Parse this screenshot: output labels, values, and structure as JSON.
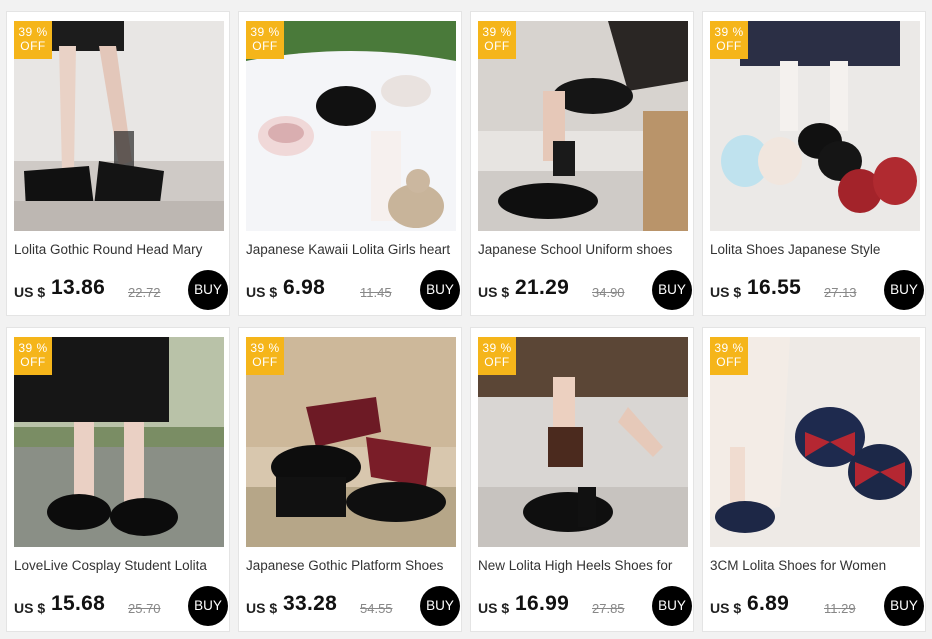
{
  "products": [
    {
      "discount_pct": "39 %",
      "discount_off": "OFF",
      "title": "Lolita Gothic Round Head Mary",
      "currency": "US $",
      "price": "13.86",
      "old_price": "22.72",
      "buy_label": "BUY",
      "image_desc": "legs-black-platform-shoes"
    },
    {
      "discount_pct": "39 %",
      "discount_off": "OFF",
      "title": "Japanese Kawaii Lolita Girls heart",
      "currency": "US $",
      "price": "6.98",
      "old_price": "11.45",
      "buy_label": "BUY",
      "image_desc": "shoes-on-white-blanket-bunny"
    },
    {
      "discount_pct": "39 %",
      "discount_off": "OFF",
      "title": "Japanese School Uniform shoes",
      "currency": "US $",
      "price": "21.29",
      "old_price": "34.90",
      "buy_label": "BUY",
      "image_desc": "black-loafers-on-steps"
    },
    {
      "discount_pct": "39 %",
      "discount_off": "OFF",
      "title": "Lolita Shoes Japanese Style",
      "currency": "US $",
      "price": "16.55",
      "old_price": "27.13",
      "buy_label": "BUY",
      "image_desc": "colorful-bow-shoes"
    },
    {
      "discount_pct": "39 %",
      "discount_off": "OFF",
      "title": "LoveLive Cosplay Student Lolita",
      "currency": "US $",
      "price": "15.68",
      "old_price": "25.70",
      "buy_label": "BUY",
      "image_desc": "platform-strap-shoes-outdoor"
    },
    {
      "discount_pct": "39 %",
      "discount_off": "OFF",
      "title": "Japanese Gothic Platform Shoes",
      "currency": "US $",
      "price": "33.28",
      "old_price": "54.55",
      "buy_label": "BUY",
      "image_desc": "platform-shoes-red-socks"
    },
    {
      "discount_pct": "39 %",
      "discount_off": "OFF",
      "title": "New Lolita High Heels Shoes for",
      "currency": "US $",
      "price": "16.99",
      "old_price": "27.85",
      "buy_label": "BUY",
      "image_desc": "patent-heels-brown-socks"
    },
    {
      "discount_pct": "39 %",
      "discount_off": "OFF",
      "title": "3CM Lolita Shoes for Women",
      "currency": "US $",
      "price": "6.89",
      "old_price": "11.29",
      "buy_label": "BUY",
      "image_desc": "navy-red-bow-shoes"
    }
  ],
  "colors": {
    "badge": "#f5b51a",
    "buy_button": "#000000",
    "background": "#f2f2f2"
  }
}
